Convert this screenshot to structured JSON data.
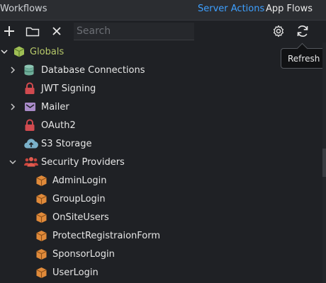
{
  "header": {
    "title": "Workflows",
    "tabs": [
      {
        "label": "Server Actions",
        "active": true
      },
      {
        "label": "App Flows",
        "active": false
      }
    ]
  },
  "toolbar": {
    "add_icon": "plus-icon",
    "folder_icon": "folder-icon",
    "delete_icon": "close-icon",
    "search_placeholder": "Search",
    "search_value": "",
    "settings_icon": "gear-icon",
    "refresh_icon": "refresh-icon"
  },
  "tooltip": {
    "text": "Refresh"
  },
  "tree": {
    "root": {
      "label": "Globals",
      "icon": "cube-icon",
      "expanded": true
    },
    "items": [
      {
        "label": "Database Connections",
        "icon": "database-icon",
        "expandable": true
      },
      {
        "label": "JWT Signing",
        "icon": "lock-icon",
        "expandable": false
      },
      {
        "label": "Mailer",
        "icon": "mail-icon",
        "expandable": true
      },
      {
        "label": "OAuth2",
        "icon": "lock-icon",
        "expandable": false
      },
      {
        "label": "S3 Storage",
        "icon": "cloud-upload-icon",
        "expandable": false
      },
      {
        "label": "Security Providers",
        "icon": "users-icon",
        "expandable": true,
        "expanded": true
      }
    ],
    "security_children": [
      {
        "label": "AdminLogin",
        "icon": "box-icon"
      },
      {
        "label": "GroupLogin",
        "icon": "box-icon"
      },
      {
        "label": "OnSiteUsers",
        "icon": "box-icon"
      },
      {
        "label": "ProtectRegistraionForm",
        "icon": "box-icon"
      },
      {
        "label": "SponsorLogin",
        "icon": "box-icon"
      },
      {
        "label": "UserLogin",
        "icon": "box-icon"
      }
    ]
  },
  "colors": {
    "accent": "#3ea0ff",
    "globals_label": "#b7c96a",
    "lock": "#d14a4f",
    "box": "#e08a3a",
    "database": "#6fae9a",
    "users": "#e05b4f"
  }
}
